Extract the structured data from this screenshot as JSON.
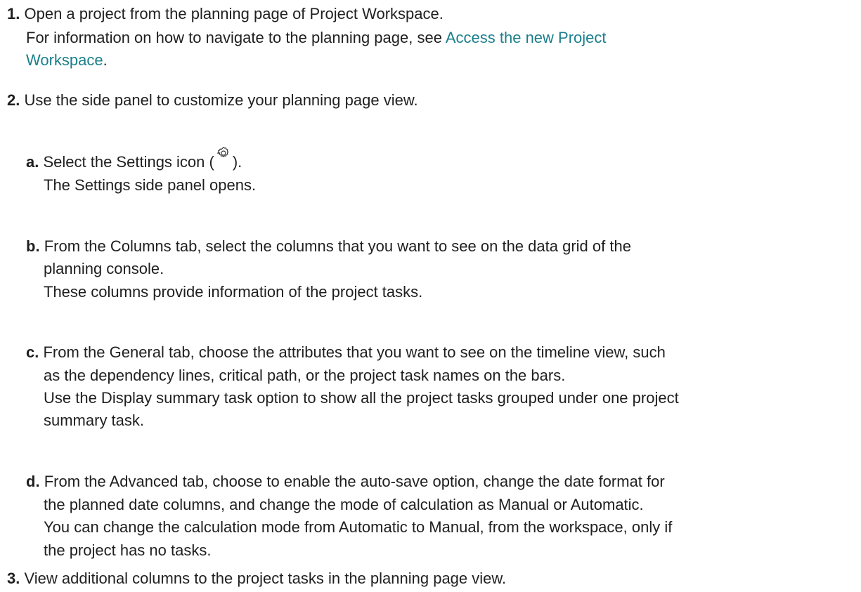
{
  "steps": [
    {
      "number": "1.",
      "lines": [
        "Open a project from the planning page of Project Workspace."
      ],
      "note_prefix": "For information on how to navigate to the planning page, see ",
      "link_line1": "Access the new Project",
      "link_line2": "Workspace",
      "note_suffix": "."
    },
    {
      "number": "2.",
      "lines": [
        "Use the side panel to customize your planning page view."
      ],
      "substeps": [
        {
          "letter": "a.",
          "text_before_icon": "Select the Settings icon (",
          "icon": "gear-icon",
          "text_after_icon": ").",
          "lines": [
            "The Settings side panel opens."
          ]
        },
        {
          "letter": "b.",
          "lines": [
            "From the Columns tab, select the columns that you want to see on the data grid of the",
            "planning console.",
            "These columns provide information of the project tasks."
          ]
        },
        {
          "letter": "c.",
          "lines": [
            "From the General tab, choose the attributes that you want to see on the timeline view, such",
            "as the dependency lines, critical path, or the project task names on the bars.",
            "Use the Display summary task option to show all the project tasks grouped under one project",
            "summary task."
          ]
        },
        {
          "letter": "d.",
          "lines": [
            "From the Advanced tab, choose to enable the auto-save option, change the date format for",
            "the planned date columns, and change the mode of calculation as Manual or Automatic.",
            "You can change the calculation mode from Automatic to Manual, from the workspace, only if",
            "the project has no tasks."
          ]
        }
      ]
    },
    {
      "number": "3.",
      "lines": [
        "View additional columns to the project tasks in the planning page view."
      ]
    }
  ]
}
